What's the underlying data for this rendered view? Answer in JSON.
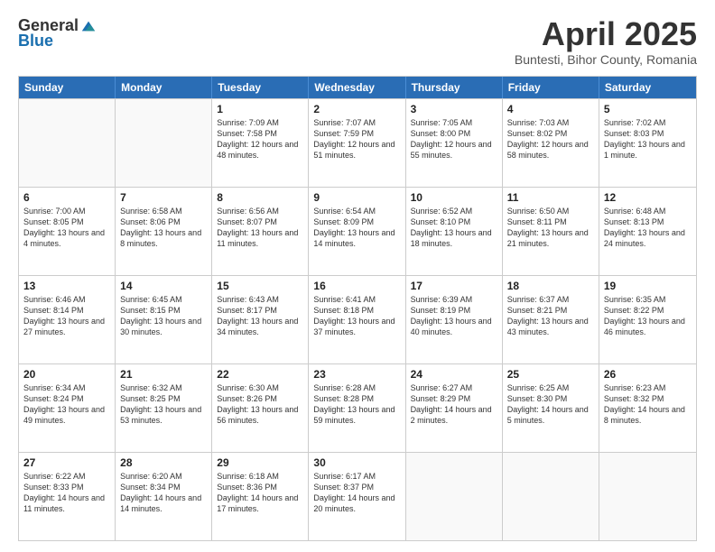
{
  "logo": {
    "general": "General",
    "blue": "Blue"
  },
  "title": "April 2025",
  "subtitle": "Buntesti, Bihor County, Romania",
  "header_days": [
    "Sunday",
    "Monday",
    "Tuesday",
    "Wednesday",
    "Thursday",
    "Friday",
    "Saturday"
  ],
  "weeks": [
    [
      {
        "day": "",
        "text": ""
      },
      {
        "day": "",
        "text": ""
      },
      {
        "day": "1",
        "text": "Sunrise: 7:09 AM\nSunset: 7:58 PM\nDaylight: 12 hours and 48 minutes."
      },
      {
        "day": "2",
        "text": "Sunrise: 7:07 AM\nSunset: 7:59 PM\nDaylight: 12 hours and 51 minutes."
      },
      {
        "day": "3",
        "text": "Sunrise: 7:05 AM\nSunset: 8:00 PM\nDaylight: 12 hours and 55 minutes."
      },
      {
        "day": "4",
        "text": "Sunrise: 7:03 AM\nSunset: 8:02 PM\nDaylight: 12 hours and 58 minutes."
      },
      {
        "day": "5",
        "text": "Sunrise: 7:02 AM\nSunset: 8:03 PM\nDaylight: 13 hours and 1 minute."
      }
    ],
    [
      {
        "day": "6",
        "text": "Sunrise: 7:00 AM\nSunset: 8:05 PM\nDaylight: 13 hours and 4 minutes."
      },
      {
        "day": "7",
        "text": "Sunrise: 6:58 AM\nSunset: 8:06 PM\nDaylight: 13 hours and 8 minutes."
      },
      {
        "day": "8",
        "text": "Sunrise: 6:56 AM\nSunset: 8:07 PM\nDaylight: 13 hours and 11 minutes."
      },
      {
        "day": "9",
        "text": "Sunrise: 6:54 AM\nSunset: 8:09 PM\nDaylight: 13 hours and 14 minutes."
      },
      {
        "day": "10",
        "text": "Sunrise: 6:52 AM\nSunset: 8:10 PM\nDaylight: 13 hours and 18 minutes."
      },
      {
        "day": "11",
        "text": "Sunrise: 6:50 AM\nSunset: 8:11 PM\nDaylight: 13 hours and 21 minutes."
      },
      {
        "day": "12",
        "text": "Sunrise: 6:48 AM\nSunset: 8:13 PM\nDaylight: 13 hours and 24 minutes."
      }
    ],
    [
      {
        "day": "13",
        "text": "Sunrise: 6:46 AM\nSunset: 8:14 PM\nDaylight: 13 hours and 27 minutes."
      },
      {
        "day": "14",
        "text": "Sunrise: 6:45 AM\nSunset: 8:15 PM\nDaylight: 13 hours and 30 minutes."
      },
      {
        "day": "15",
        "text": "Sunrise: 6:43 AM\nSunset: 8:17 PM\nDaylight: 13 hours and 34 minutes."
      },
      {
        "day": "16",
        "text": "Sunrise: 6:41 AM\nSunset: 8:18 PM\nDaylight: 13 hours and 37 minutes."
      },
      {
        "day": "17",
        "text": "Sunrise: 6:39 AM\nSunset: 8:19 PM\nDaylight: 13 hours and 40 minutes."
      },
      {
        "day": "18",
        "text": "Sunrise: 6:37 AM\nSunset: 8:21 PM\nDaylight: 13 hours and 43 minutes."
      },
      {
        "day": "19",
        "text": "Sunrise: 6:35 AM\nSunset: 8:22 PM\nDaylight: 13 hours and 46 minutes."
      }
    ],
    [
      {
        "day": "20",
        "text": "Sunrise: 6:34 AM\nSunset: 8:24 PM\nDaylight: 13 hours and 49 minutes."
      },
      {
        "day": "21",
        "text": "Sunrise: 6:32 AM\nSunset: 8:25 PM\nDaylight: 13 hours and 53 minutes."
      },
      {
        "day": "22",
        "text": "Sunrise: 6:30 AM\nSunset: 8:26 PM\nDaylight: 13 hours and 56 minutes."
      },
      {
        "day": "23",
        "text": "Sunrise: 6:28 AM\nSunset: 8:28 PM\nDaylight: 13 hours and 59 minutes."
      },
      {
        "day": "24",
        "text": "Sunrise: 6:27 AM\nSunset: 8:29 PM\nDaylight: 14 hours and 2 minutes."
      },
      {
        "day": "25",
        "text": "Sunrise: 6:25 AM\nSunset: 8:30 PM\nDaylight: 14 hours and 5 minutes."
      },
      {
        "day": "26",
        "text": "Sunrise: 6:23 AM\nSunset: 8:32 PM\nDaylight: 14 hours and 8 minutes."
      }
    ],
    [
      {
        "day": "27",
        "text": "Sunrise: 6:22 AM\nSunset: 8:33 PM\nDaylight: 14 hours and 11 minutes."
      },
      {
        "day": "28",
        "text": "Sunrise: 6:20 AM\nSunset: 8:34 PM\nDaylight: 14 hours and 14 minutes."
      },
      {
        "day": "29",
        "text": "Sunrise: 6:18 AM\nSunset: 8:36 PM\nDaylight: 14 hours and 17 minutes."
      },
      {
        "day": "30",
        "text": "Sunrise: 6:17 AM\nSunset: 8:37 PM\nDaylight: 14 hours and 20 minutes."
      },
      {
        "day": "",
        "text": ""
      },
      {
        "day": "",
        "text": ""
      },
      {
        "day": "",
        "text": ""
      }
    ]
  ]
}
